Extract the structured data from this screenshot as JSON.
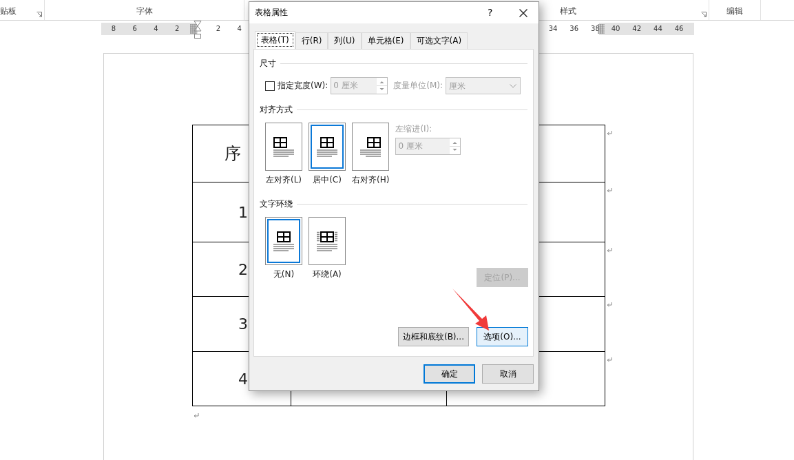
{
  "ribbon": {
    "groups": [
      {
        "label": "贴板",
        "launcher": true
      },
      {
        "label": "字体",
        "launcher": false
      },
      {
        "label": "样式",
        "launcher": true
      },
      {
        "label": "编辑",
        "launcher": false
      }
    ]
  },
  "ruler": {
    "segments": [
      {
        "ticks": [
          "8",
          "6",
          "4",
          "2"
        ]
      },
      {
        "ticks": [
          "2",
          "4"
        ]
      },
      {
        "ticks": [
          "34",
          "36",
          "38"
        ]
      },
      {
        "ticks": [
          "40",
          "42",
          "44",
          "46"
        ]
      }
    ]
  },
  "document": {
    "table_rows": [
      {
        "cell_1": "序"
      },
      {
        "cell_1": "1"
      },
      {
        "cell_1": "2"
      },
      {
        "cell_1": "3"
      },
      {
        "cell_1": "4"
      }
    ]
  },
  "dialog": {
    "title": "表格属性",
    "help": "?",
    "tabs": [
      {
        "label": "表格(T)",
        "selected": true
      },
      {
        "label": "行(R)",
        "selected": false
      },
      {
        "label": "列(U)",
        "selected": false
      },
      {
        "label": "单元格(E)",
        "selected": false
      },
      {
        "label": "可选文字(A)",
        "selected": false
      }
    ],
    "size": {
      "heading": "尺寸",
      "width_checkbox": {
        "label": "指定宽度(W):",
        "checked": false
      },
      "width_field": {
        "value": "0 厘米",
        "disabled": true
      },
      "unit_label": "度量单位(M):",
      "unit_select": {
        "value": "厘米",
        "disabled": true
      }
    },
    "alignment": {
      "heading": "对齐方式",
      "options": [
        {
          "kind": "left",
          "label": "左对齐(L)",
          "selected": false
        },
        {
          "kind": "center",
          "label": "居中(C)",
          "selected": true
        },
        {
          "kind": "right",
          "label": "右对齐(H)",
          "selected": false
        }
      ],
      "indent_label": "左缩进(I):",
      "indent_field": {
        "value": "0 厘米",
        "disabled": true
      }
    },
    "wrapping": {
      "heading": "文字环绕",
      "options": [
        {
          "kind": "none",
          "label": "无(N)",
          "selected": true
        },
        {
          "kind": "around",
          "label": "环绕(A)",
          "selected": false
        }
      ],
      "position_button": {
        "label": "定位(P)...",
        "disabled": true
      }
    },
    "panel_buttons": [
      {
        "label": "边框和底纹(B)...",
        "highlighted": false
      },
      {
        "label": "选项(O)...",
        "highlighted": true
      }
    ],
    "footer_buttons": [
      {
        "label": "确定",
        "default": true
      },
      {
        "label": "取消",
        "default": false
      }
    ]
  }
}
